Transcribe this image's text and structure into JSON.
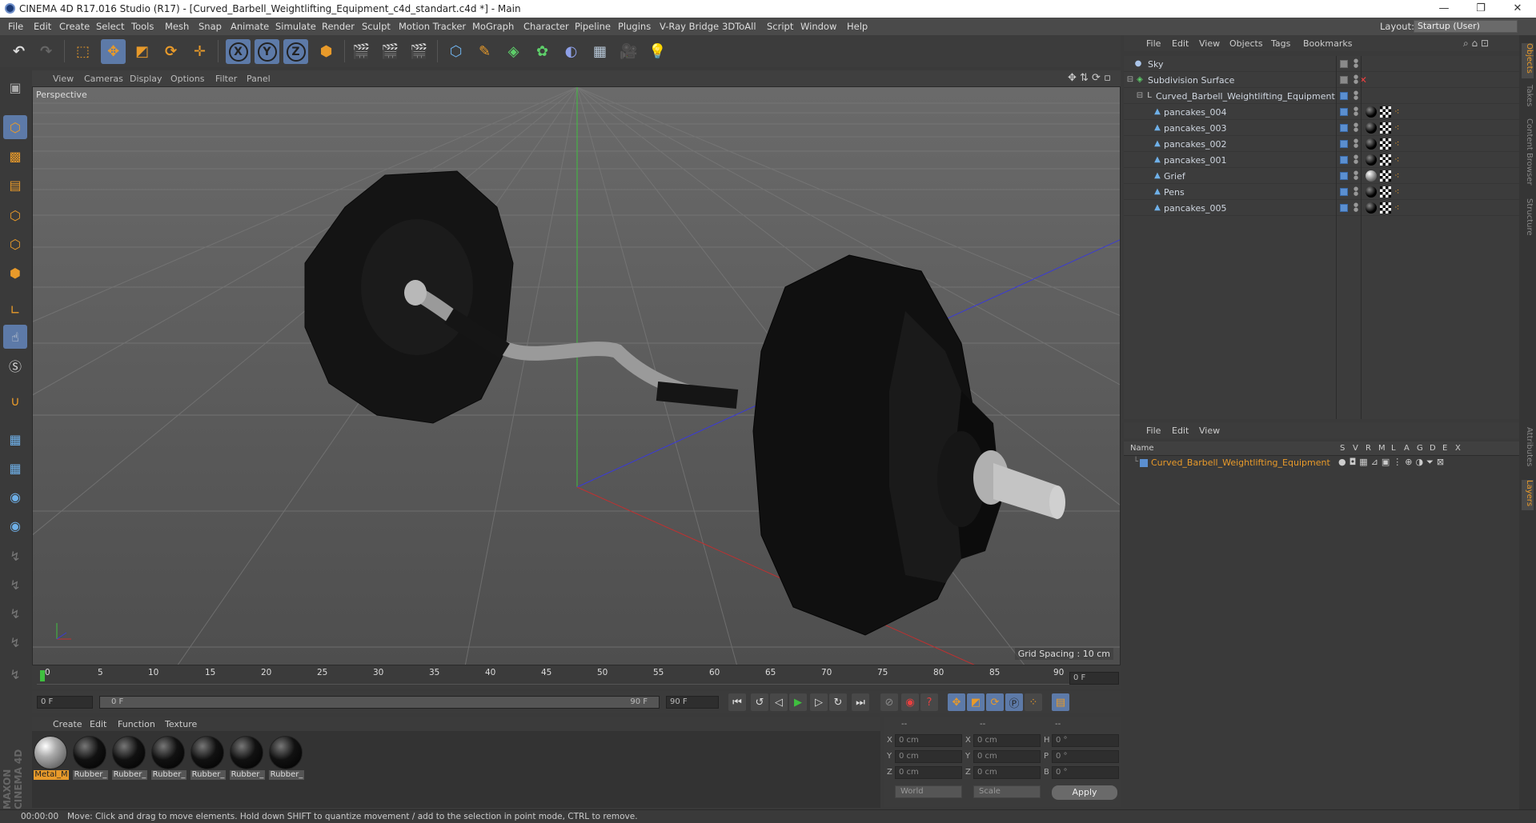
{
  "window": {
    "title": "CINEMA 4D R17.016 Studio (R17) - [Curved_Barbell_Weightlifting_Equipment_c4d_standart.c4d *] - Main",
    "minimize": "—",
    "maximize": "❐",
    "close": "✕"
  },
  "menu": [
    "File",
    "Edit",
    "Create",
    "Select",
    "Tools",
    "Mesh",
    "Snap",
    "Animate",
    "Simulate",
    "Render",
    "Sculpt",
    "Motion Tracker",
    "MoGraph",
    "Character",
    "Pipeline",
    "Plugins",
    "V-Ray Bridge",
    "3DToAll",
    "Script",
    "Window",
    "Help"
  ],
  "layout": {
    "label": "Layout:",
    "value": "Startup (User)"
  },
  "toolbar": {
    "x_label": "X",
    "y_label": "Y",
    "z_label": "Z"
  },
  "viewport": {
    "menu": [
      "View",
      "Cameras",
      "Display",
      "Options",
      "Filter",
      "Panel"
    ],
    "label": "Perspective",
    "grid_spacing": "Grid Spacing : 10 cm"
  },
  "timeline": {
    "ticks": [
      "0",
      "5",
      "10",
      "15",
      "20",
      "25",
      "30",
      "35",
      "40",
      "45",
      "50",
      "55",
      "60",
      "65",
      "70",
      "75",
      "80",
      "85",
      "90"
    ],
    "current_frame": "0 F"
  },
  "transport": {
    "start": "0 F",
    "range_start": "0 F",
    "range_end": "90 F",
    "end": "90 F"
  },
  "material_menu": [
    "Create",
    "Edit",
    "Function",
    "Texture"
  ],
  "materials": [
    {
      "label": "Metal_M",
      "type": "metal",
      "selected": true
    },
    {
      "label": "Rubber_",
      "type": "rubber",
      "selected": false
    },
    {
      "label": "Rubber_",
      "type": "rubber",
      "selected": false
    },
    {
      "label": "Rubber_",
      "type": "rubber",
      "selected": false
    },
    {
      "label": "Rubber_",
      "type": "rubber",
      "selected": false
    },
    {
      "label": "Rubber_",
      "type": "rubber",
      "selected": false
    },
    {
      "label": "Rubber_",
      "type": "rubber",
      "selected": false
    }
  ],
  "coords": {
    "header_left": "--",
    "header_mid": "--",
    "header_right": "--",
    "rows": [
      {
        "a": "X",
        "av": "0 cm",
        "b": "X",
        "bv": "0 cm",
        "c": "H",
        "cv": "0 °"
      },
      {
        "a": "Y",
        "av": "0 cm",
        "b": "Y",
        "bv": "0 cm",
        "c": "P",
        "cv": "0 °"
      },
      {
        "a": "Z",
        "av": "0 cm",
        "b": "Z",
        "bv": "0 cm",
        "c": "B",
        "cv": "0 °"
      }
    ],
    "space": "World",
    "mode": "Scale",
    "apply": "Apply"
  },
  "status": {
    "time": "00:00:00",
    "message": "Move: Click and drag to move elements. Hold down SHIFT to quantize movement / add to the selection in point mode, CTRL to remove."
  },
  "object_manager": {
    "menu": [
      "File",
      "Edit",
      "View",
      "Objects",
      "Tags",
      "Bookmarks"
    ],
    "objects": [
      {
        "name": "Sky",
        "indent": 0,
        "icon": "sky",
        "tags": []
      },
      {
        "name": "Subdivision Surface",
        "indent": 0,
        "icon": "subdiv",
        "tags": []
      },
      {
        "name": "Curved_Barbell_Weightlifting_Equipment",
        "indent": 1,
        "icon": "null",
        "tags": []
      },
      {
        "name": "pancakes_004",
        "indent": 2,
        "icon": "poly",
        "tags": [
          "rubber"
        ]
      },
      {
        "name": "pancakes_003",
        "indent": 2,
        "icon": "poly",
        "tags": [
          "rubber"
        ]
      },
      {
        "name": "pancakes_002",
        "indent": 2,
        "icon": "poly",
        "tags": [
          "rubber"
        ]
      },
      {
        "name": "pancakes_001",
        "indent": 2,
        "icon": "poly",
        "tags": [
          "rubber"
        ]
      },
      {
        "name": "Grief",
        "indent": 2,
        "icon": "poly",
        "tags": [
          "metal"
        ]
      },
      {
        "name": "Pens",
        "indent": 2,
        "icon": "poly",
        "tags": [
          "rubber"
        ]
      },
      {
        "name": "pancakes_005",
        "indent": 2,
        "icon": "poly",
        "tags": [
          "rubber"
        ]
      }
    ]
  },
  "layer_manager": {
    "menu": [
      "File",
      "Edit",
      "View"
    ],
    "columns": [
      "Name",
      "S",
      "V",
      "R",
      "M",
      "L",
      "A",
      "G",
      "D",
      "E",
      "X"
    ],
    "layers": [
      {
        "name": "Curved_Barbell_Weightlifting_Equipment"
      }
    ]
  },
  "right_tabs": [
    "Objects",
    "Takes",
    "Content Browser",
    "Structure",
    "Attributes",
    "Layers"
  ],
  "colors": {
    "accent": "#e89a2a",
    "selection": "#5d7aa8",
    "layer_name": "#e89a2a"
  }
}
